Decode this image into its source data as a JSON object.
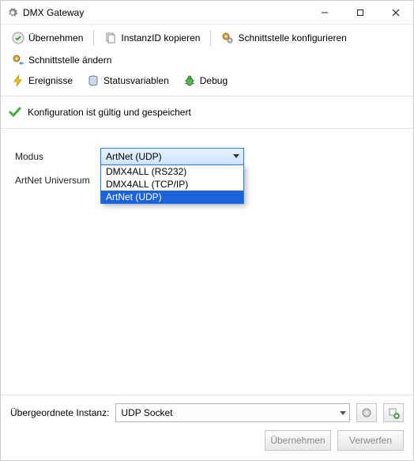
{
  "window": {
    "title": "DMX Gateway"
  },
  "toolbar": {
    "apply": "Übernehmen",
    "copy_instance": "InstanzID kopieren",
    "configure_interface": "Schnittstelle konfigurieren",
    "change_interface": "Schnittstelle ändern",
    "events": "Ereignisse",
    "status_vars": "Statusvariablen",
    "debug": "Debug"
  },
  "status": {
    "message": "Konfiguration ist gültig und gespeichert"
  },
  "form": {
    "mode_label": "Modus",
    "mode_selected": "ArtNet (UDP)",
    "mode_options": {
      "opt1": "DMX4ALL (RS232)",
      "opt2": "DMX4ALL (TCP/IP)",
      "opt3": "ArtNet (UDP)"
    },
    "universe_label": "ArtNet Universum"
  },
  "footer": {
    "parent_label": "Übergeordnete Instanz:",
    "parent_value": "UDP Socket",
    "action_apply": "Übernehmen",
    "action_discard": "Verwerfen"
  }
}
